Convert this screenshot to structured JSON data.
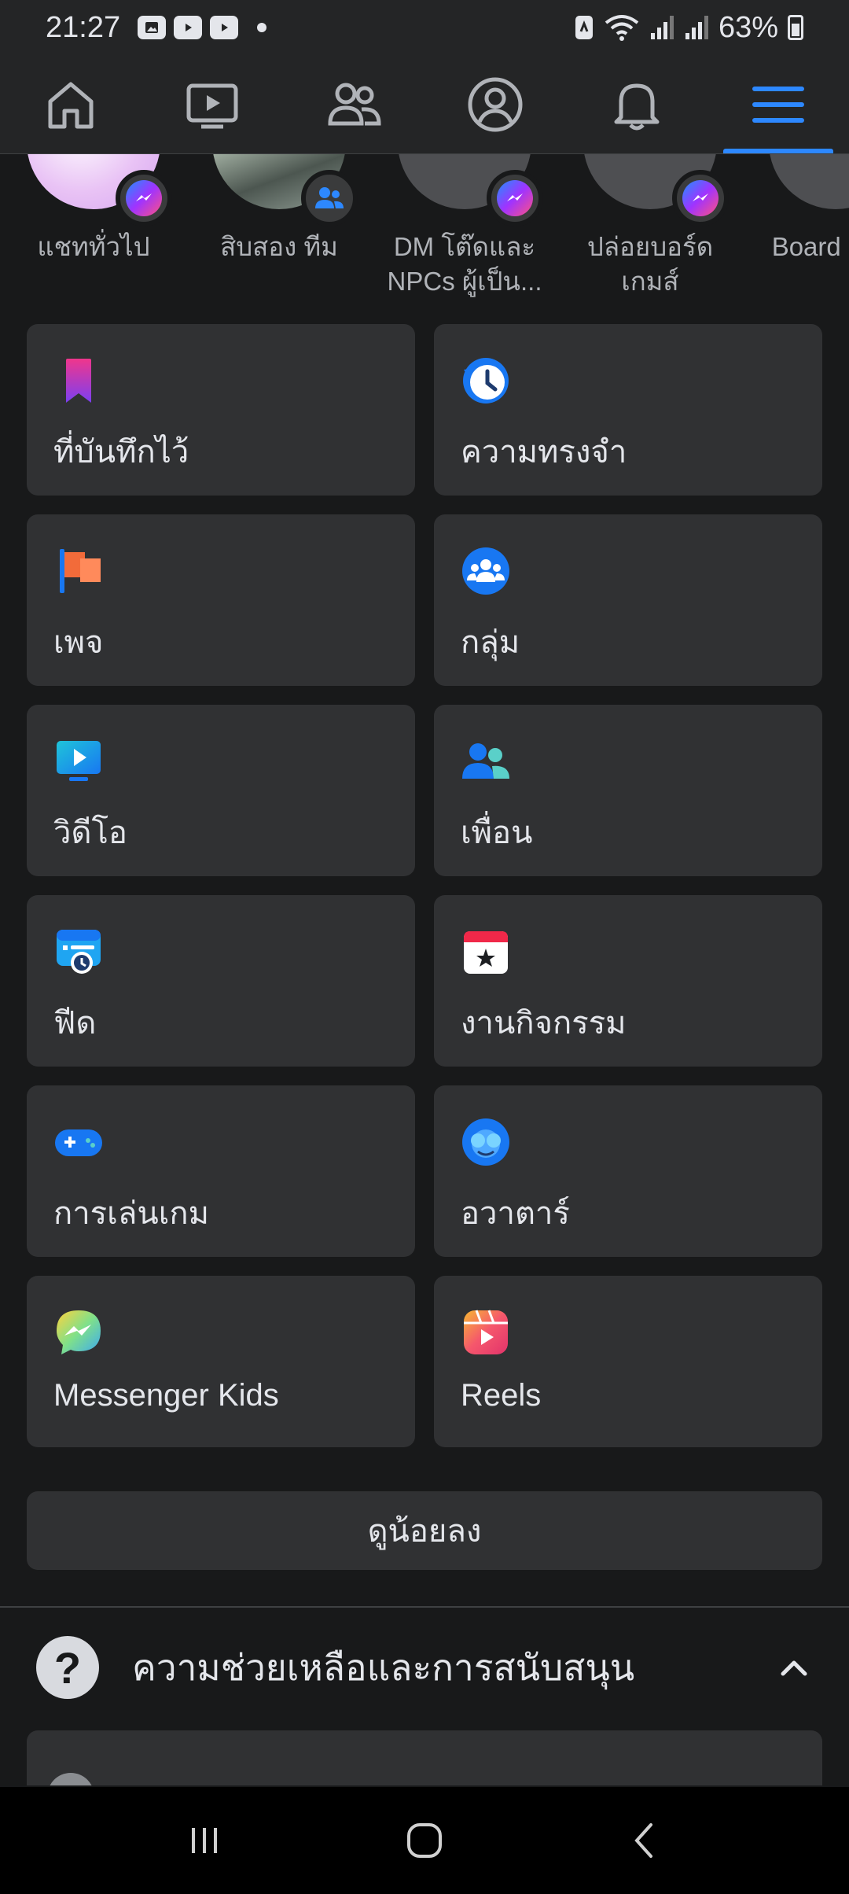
{
  "status_bar": {
    "time": "21:27",
    "battery": "63%",
    "icons": [
      "gallery-icon",
      "youtube-icon",
      "youtube-icon",
      "dot-icon",
      "nfc-icon",
      "wifi-icon",
      "signal-icon",
      "signal-icon",
      "battery-icon"
    ]
  },
  "nav": {
    "tabs": [
      {
        "name": "home",
        "icon": "home-icon"
      },
      {
        "name": "watch",
        "icon": "video-icon"
      },
      {
        "name": "friends",
        "icon": "friends-icon"
      },
      {
        "name": "profile",
        "icon": "profile-icon"
      },
      {
        "name": "notifications",
        "icon": "bell-icon"
      },
      {
        "name": "menu",
        "icon": "menu-icon",
        "active": true
      }
    ]
  },
  "shortcuts": [
    {
      "label": "แชททั่วไป",
      "badge": "messenger"
    },
    {
      "label": "สิบสอง ทีม",
      "badge": "group"
    },
    {
      "label": "DM โต๊ดและ NPCs ผู้เป็น...",
      "badge": "messenger"
    },
    {
      "label": "ปล่อยบอร์ดเกมส์",
      "badge": "messenger"
    },
    {
      "label": "Board g จิ๋ว",
      "badge": "messenger"
    }
  ],
  "menu": {
    "items": [
      {
        "label": "ที่บันทึกไว้",
        "icon": "bookmark-icon"
      },
      {
        "label": "ความทรงจำ",
        "icon": "memories-clock-icon"
      },
      {
        "label": "เพจ",
        "icon": "flag-icon"
      },
      {
        "label": "กลุ่ม",
        "icon": "groups-icon"
      },
      {
        "label": "วิดีโอ",
        "icon": "video-tv-icon"
      },
      {
        "label": "เพื่อน",
        "icon": "friends-icon"
      },
      {
        "label": "ฟีด",
        "icon": "feed-icon"
      },
      {
        "label": "งานกิจกรรม",
        "icon": "events-calendar-icon"
      },
      {
        "label": "การเล่นเกม",
        "icon": "gamepad-icon"
      },
      {
        "label": "อวาตาร์",
        "icon": "avatar-icon"
      },
      {
        "label": "Messenger Kids",
        "icon": "messenger-kids-icon"
      },
      {
        "label": "Reels",
        "icon": "reels-icon"
      }
    ],
    "see_less": "ดูน้อยลง"
  },
  "help": {
    "label": "ความช่วยเหลือและการสนับสนุน",
    "icon_glyph": "?"
  },
  "colors": {
    "background": "#18191a",
    "card": "#303133",
    "accent": "#2d88ff",
    "text": "#e4e6eb",
    "muted": "#b0b3b8"
  }
}
